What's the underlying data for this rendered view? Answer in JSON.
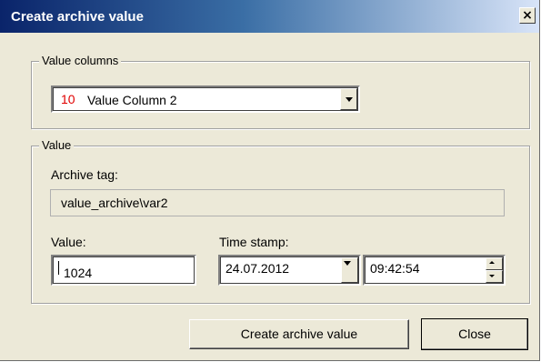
{
  "window": {
    "title": "Create archive value",
    "close_glyph": "✕"
  },
  "value_columns": {
    "legend": "Value columns",
    "selected_number": "10",
    "selected_label": "Value Column 2"
  },
  "value_group": {
    "legend": "Value",
    "archive_tag_label": "Archive tag:",
    "archive_tag_value": "value_archive\\var2",
    "value_label": "Value:",
    "value_input": "1024",
    "timestamp_label": "Time stamp:",
    "date_value": "24.07.2012",
    "time_value": "09:42:54"
  },
  "buttons": {
    "create": "Create archive value",
    "close": "Close"
  },
  "colors": {
    "title_bar_start": "#0a246a",
    "title_bar_end": "#d8e4f8",
    "dialog_face": "#ece9d8",
    "column_number": "#e00000"
  },
  "icons": {
    "close": "close-icon",
    "dropdown": "chevron-down-icon",
    "spin_up": "spin-up-icon",
    "spin_down": "spin-down-icon"
  }
}
